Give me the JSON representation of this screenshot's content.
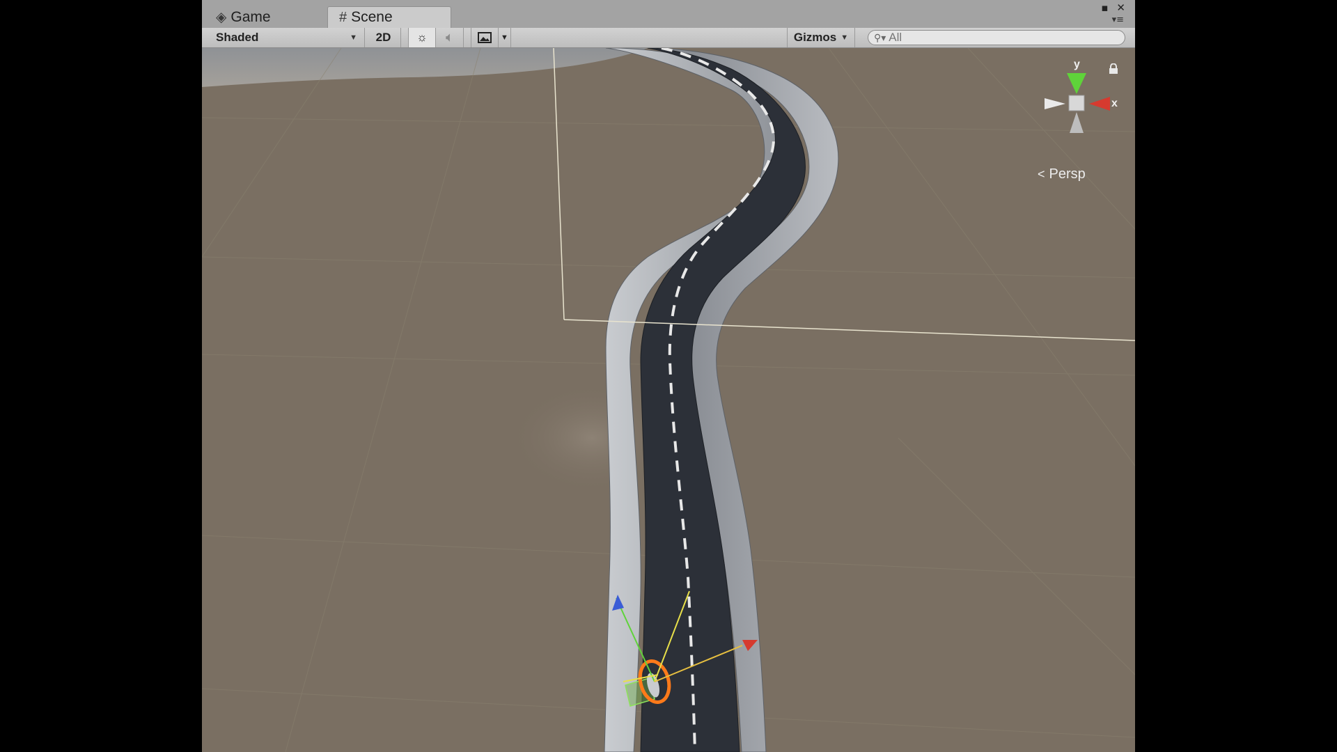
{
  "tabs": {
    "game_label": "Game",
    "scene_label": "Scene",
    "active": "Scene"
  },
  "toolbar": {
    "shading_mode": "Shaded",
    "twod_label": "2D",
    "gizmos_label": "Gizmos",
    "search_placeholder": "All"
  },
  "viewport": {
    "projection_label": "Persp",
    "axis_labels": {
      "y": "y",
      "x": "x"
    }
  },
  "icons": {
    "game_tab": "game-controller-icon",
    "scene_tab": "grid-hash-icon",
    "lighting": "sun-icon",
    "audio": "speaker-icon",
    "effects": "image-icon",
    "search": "magnifier-icon",
    "lock": "lock-icon"
  },
  "colors": {
    "ground": "#7a6f62",
    "sky": "#8f9296",
    "road_asphalt": "#2c3038",
    "road_wall": "#a9adb2",
    "axis_x": "#d63a2f",
    "axis_y": "#5fd33a",
    "axis_z": "#3a5cd6",
    "selection_outline": "#ff7a1a"
  }
}
